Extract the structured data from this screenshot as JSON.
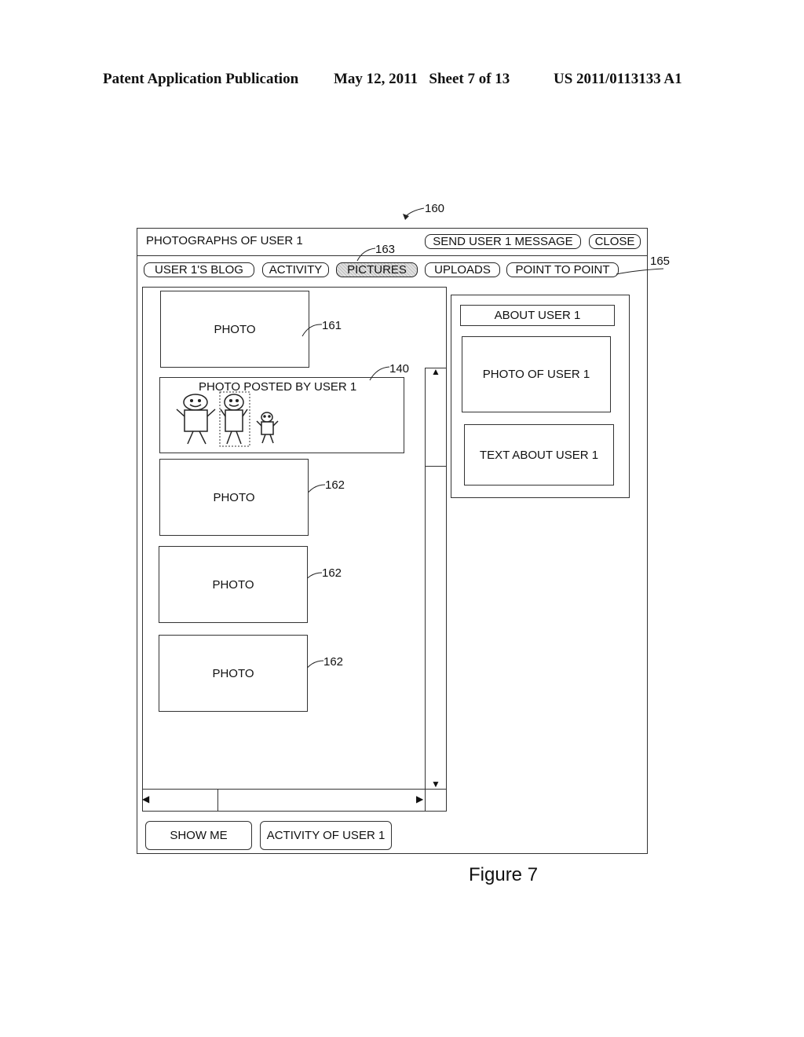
{
  "header": {
    "publication": "Patent Application Publication",
    "date_sheet": "May 12, 2011   Sheet 7 of 13",
    "patent_number": "US 2011/0113133 A1"
  },
  "window": {
    "ref": "160",
    "title": "PHOTOGRAPHS OF USER 1",
    "send_message_label": "SEND USER 1 MESSAGE",
    "close_label": "CLOSE"
  },
  "tabs": {
    "ref_pictures": "163",
    "ref_tabbar": "165",
    "items": [
      {
        "label": "USER 1'S BLOG",
        "active": false
      },
      {
        "label": "ACTIVITY",
        "active": false
      },
      {
        "label": "PICTURES",
        "active": true
      },
      {
        "label": "UPLOADS",
        "active": false
      },
      {
        "label": "POINT TO POINT",
        "active": false
      }
    ]
  },
  "feed": {
    "photo_top": {
      "label": "PHOTO",
      "ref": "161"
    },
    "posted": {
      "label": "PHOTO POSTED BY USER 1",
      "ref": "140"
    },
    "photos": [
      {
        "label": "PHOTO",
        "ref": "162"
      },
      {
        "label": "PHOTO",
        "ref": "162"
      },
      {
        "label": "PHOTO",
        "ref": "162"
      }
    ],
    "scroll_up_icon": "▲",
    "scroll_down_icon": "▼",
    "scroll_left_icon": "◀",
    "scroll_right_icon": "▶"
  },
  "about": {
    "title": "ABOUT USER 1",
    "photo_label": "PHOTO OF USER 1",
    "text_label": "TEXT ABOUT USER 1"
  },
  "footer_buttons": {
    "show_me": "SHOW ME",
    "activity": "ACTIVITY OF USER 1"
  },
  "figure_caption": "Figure 7"
}
